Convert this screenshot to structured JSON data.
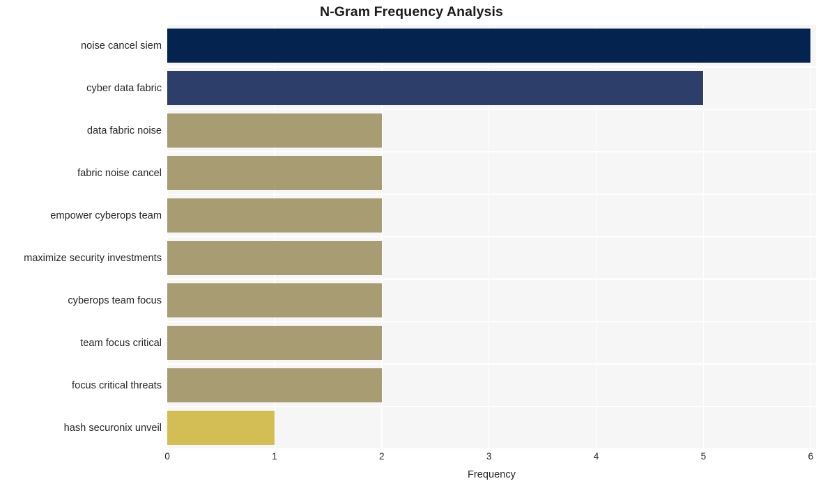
{
  "chart_data": {
    "type": "bar",
    "orientation": "horizontal",
    "title": "N-Gram Frequency Analysis",
    "xlabel": "Frequency",
    "ylabel": "",
    "categories": [
      "noise cancel siem",
      "cyber data fabric",
      "data fabric noise",
      "fabric noise cancel",
      "empower cyberops team",
      "maximize security investments",
      "cyberops team focus",
      "team focus critical",
      "focus critical threats",
      "hash securonix unveil"
    ],
    "values": [
      6,
      5,
      2,
      2,
      2,
      2,
      2,
      2,
      2,
      1
    ],
    "bar_colors": [
      "#04244f",
      "#2e3e6b",
      "#a89c72",
      "#a89c72",
      "#a89c72",
      "#a89c72",
      "#a89c72",
      "#a89c72",
      "#a89c72",
      "#d3be55"
    ],
    "xlim": [
      0,
      6.05
    ],
    "xticks": [
      0,
      1,
      2,
      3,
      4,
      5,
      6
    ],
    "xtick_labels": [
      "0",
      "1",
      "2",
      "3",
      "4",
      "5",
      "6"
    ],
    "grid": true,
    "grid_color": "#ffffff",
    "plot_background": "#f6f6f6",
    "figure_background": "#ffffff",
    "legend": null
  }
}
